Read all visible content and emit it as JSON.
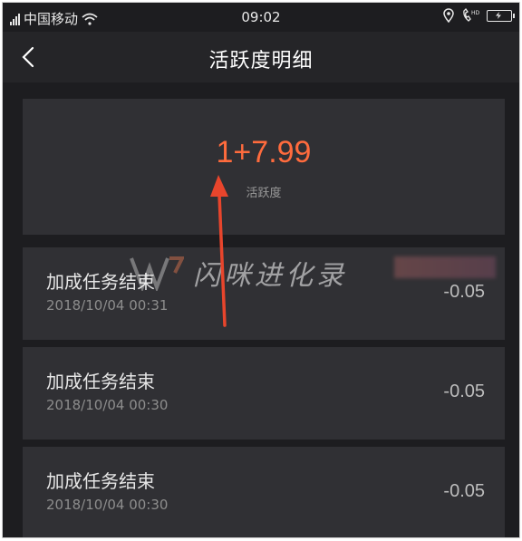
{
  "status_bar": {
    "carrier": "中国移动",
    "time": "09:02",
    "icons": [
      "signal-icon",
      "wifi-icon",
      "location-icon",
      "hd-call-icon",
      "battery-charging-icon"
    ]
  },
  "nav": {
    "back_icon": "chevron-left-icon",
    "title": "活跃度明细"
  },
  "summary": {
    "value": "1+7.99",
    "label": "活跃度",
    "value_color": "#ff6b3d"
  },
  "records": [
    {
      "title": "加成任务结束",
      "time": "2018/10/04 00:31",
      "value": "-0.05"
    },
    {
      "title": "加成任务结束",
      "time": "2018/10/04 00:30",
      "value": "-0.05"
    },
    {
      "title": "加成任务结束",
      "time": "2018/10/04 00:30",
      "value": "-0.05"
    }
  ],
  "annotation": {
    "arrow_color": "#e8452c"
  },
  "watermark": {
    "text": "闪咪进化录"
  }
}
